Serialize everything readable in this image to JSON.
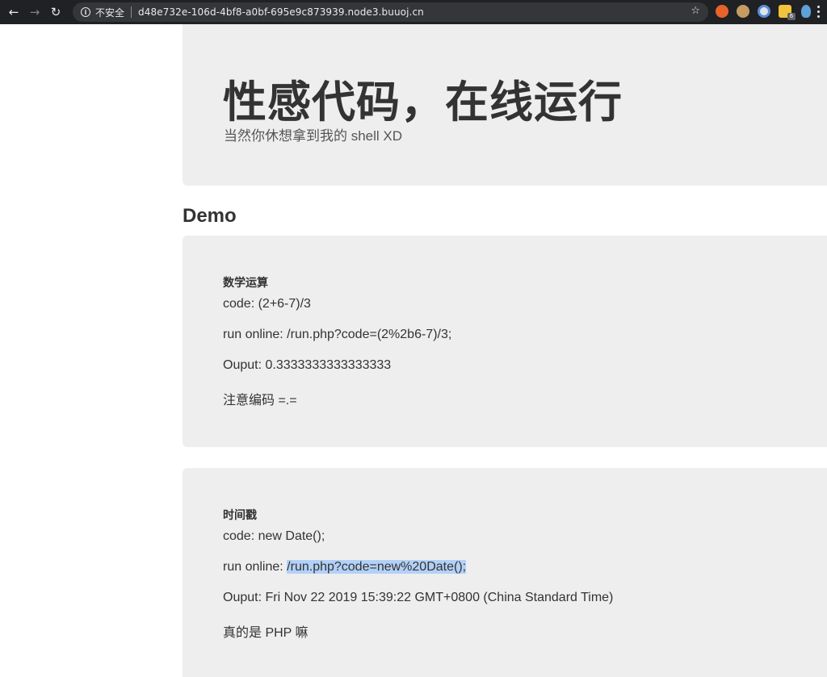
{
  "browser": {
    "security_label": "不安全",
    "url": "d48e732e-106d-4bf8-a0bf-695e9c873939.node3.buuoj.cn",
    "extension_badge": "6",
    "icons": [
      "back-arrow-icon",
      "forward-arrow-icon",
      "reload-icon",
      "info-icon",
      "star-icon"
    ]
  },
  "jumbotron": {
    "title": "性感代码，在线运行",
    "subtitle": "当然你休想拿到我的 shell XD"
  },
  "demo": {
    "heading": "Demo",
    "cards": [
      {
        "title": "数学运算",
        "code_line": "code: (2+6-7)/3",
        "run_prefix": "run online: ",
        "run_url": "/run.php?code=(2%2b6-7)/3;",
        "output_line": "Ouput: 0.3333333333333333",
        "note": "注意编码 =.="
      },
      {
        "title": "时间戳",
        "code_line": "code: new Date();",
        "run_prefix": "run online: ",
        "run_url": "/run.php?code=new%20Date();",
        "output_line": "Ouput: Fri Nov 22 2019 15:39:22 GMT+0800 (China Standard Time)",
        "note": "真的是 PHP 嘛"
      }
    ]
  },
  "colors": {
    "chrome_bg": "#202124",
    "panel_bg": "#eeeeee",
    "selection": "#b3d1f7"
  }
}
